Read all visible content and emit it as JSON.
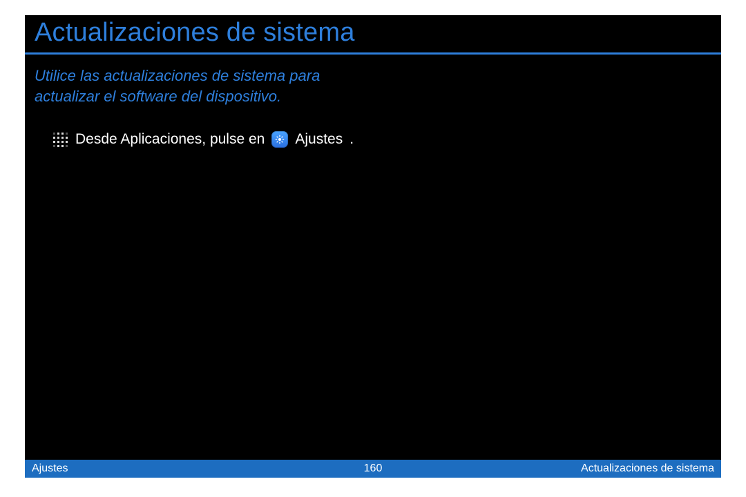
{
  "title": "Actualizaciones de sistema",
  "intro": "Utilice las actualizaciones de sistema para actualizar el software del dispositivo.",
  "instruction": {
    "step1": "Desde Aplicaciones, pulse en",
    "settings_label": "Ajustes",
    "after": "."
  },
  "footer": {
    "left": "Ajustes",
    "page": "160",
    "right": "Actualizaciones de sistema"
  }
}
